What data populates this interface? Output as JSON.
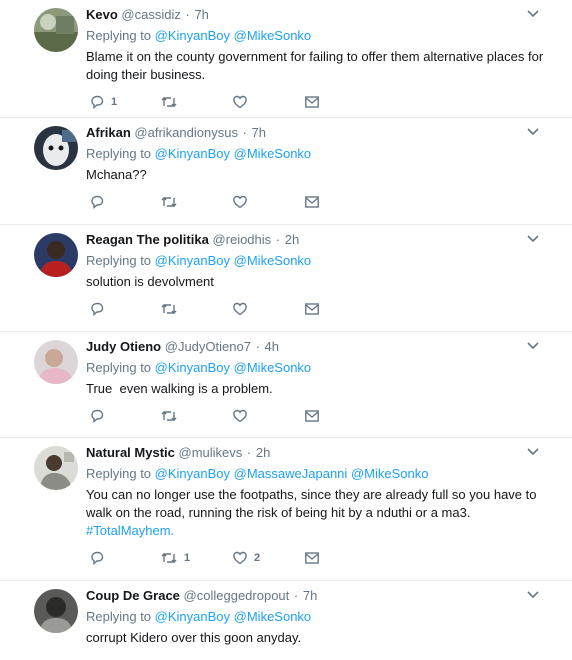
{
  "colors": {
    "link": "#1da1f2",
    "muted": "#657786",
    "text": "#14171a",
    "divider": "#e6ecf0"
  },
  "icons": {
    "reply": "reply-icon",
    "retweet": "retweet-icon",
    "like": "heart-icon",
    "dm": "envelope-icon",
    "caret": "chevron-down-icon"
  },
  "tweets": [
    {
      "name": "Kevo",
      "handle": "@cassidiz",
      "time": "7h",
      "replying_prefix": "Replying to",
      "mentions": [
        "@KinyanBoy",
        "@MikeSonko"
      ],
      "text": "Blame it on the county government for failing to offer them alternative places for doing their business.",
      "reply_count": "1",
      "retweet_count": "",
      "like_count": ""
    },
    {
      "name": "Afrikan",
      "handle": "@afrikandionysus",
      "time": "7h",
      "replying_prefix": "Replying to",
      "mentions": [
        "@KinyanBoy",
        "@MikeSonko"
      ],
      "text": "Mchana??",
      "reply_count": "",
      "retweet_count": "",
      "like_count": ""
    },
    {
      "name": "Reagan The politika",
      "handle": "@reiodhis",
      "time": "2h",
      "replying_prefix": "Replying to",
      "mentions": [
        "@KinyanBoy",
        "@MikeSonko"
      ],
      "text": "solution is devolvment",
      "reply_count": "",
      "retweet_count": "",
      "like_count": ""
    },
    {
      "name": "Judy Otieno",
      "handle": "@JudyOtieno7",
      "time": "4h",
      "replying_prefix": "Replying to",
      "mentions": [
        "@KinyanBoy",
        "@MikeSonko"
      ],
      "text": "True  even walking is a problem.",
      "reply_count": "",
      "retweet_count": "",
      "like_count": ""
    },
    {
      "name": "Natural Mystic",
      "handle": "@mulikevs",
      "time": "2h",
      "replying_prefix": "Replying to",
      "mentions": [
        "@KinyanBoy",
        "@MassaweJapanni",
        "@MikeSonko"
      ],
      "text": "You can no longer use the footpaths, since they are already full so you have to walk on the road, running the risk of being hit by a nduthi or a ma3.",
      "hashtag": "#TotalMayhem.",
      "reply_count": "",
      "retweet_count": "1",
      "like_count": "2"
    },
    {
      "name": "Coup De Grace",
      "handle": "@colleggedropout",
      "time": "7h",
      "replying_prefix": "Replying to",
      "mentions": [
        "@KinyanBoy",
        "@MikeSonko"
      ],
      "text": "corrupt Kidero over this goon anyday.",
      "reply_count": "",
      "retweet_count": "",
      "like_count": ""
    }
  ]
}
